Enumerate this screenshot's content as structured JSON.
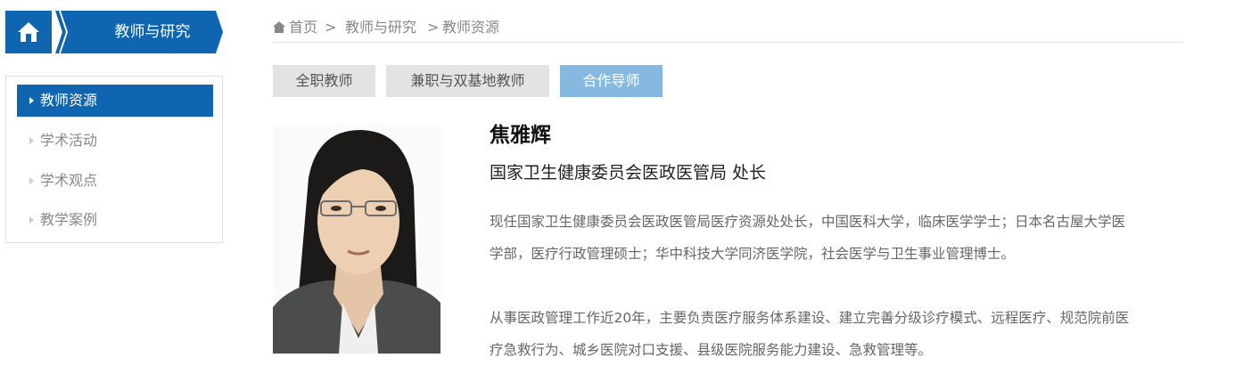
{
  "section": {
    "title": "教师与研究",
    "color": "#0f65b0"
  },
  "sidebar": {
    "items": [
      {
        "label": "教师资源",
        "active": true
      },
      {
        "label": "学术活动",
        "active": false
      },
      {
        "label": "学术观点",
        "active": false
      },
      {
        "label": "教学案例",
        "active": false
      }
    ]
  },
  "breadcrumb": {
    "home": "首页",
    "sep": ">",
    "level1": "教师与研究",
    "level2": "教师资源"
  },
  "tabs": [
    {
      "label": "全职教师",
      "active": false
    },
    {
      "label": "兼职与双基地教师",
      "active": false
    },
    {
      "label": "合作导师",
      "active": true
    }
  ],
  "profile": {
    "name": "焦雅辉",
    "title": "国家卫生健康委员会医政医管局 处长",
    "bio1_line1": "现任国家卫生健康委员会医政医管局医疗资源处处长，中国医科大学，临床医学学士；日本名古屋大学医",
    "bio1_line2": "学部，医疗行政管理硕士；华中科技大学同济医学院，社会医学与卫生事业管理博士。",
    "bio2_line1": "从事医政管理工作近20年，主要负责医疗服务体系建设、建立完善分级诊疗模式、远程医疗、规范院前医",
    "bio2_line2": "疗急救行为、城乡医院对口支援、县级医院服务能力建设、急救管理等。"
  }
}
